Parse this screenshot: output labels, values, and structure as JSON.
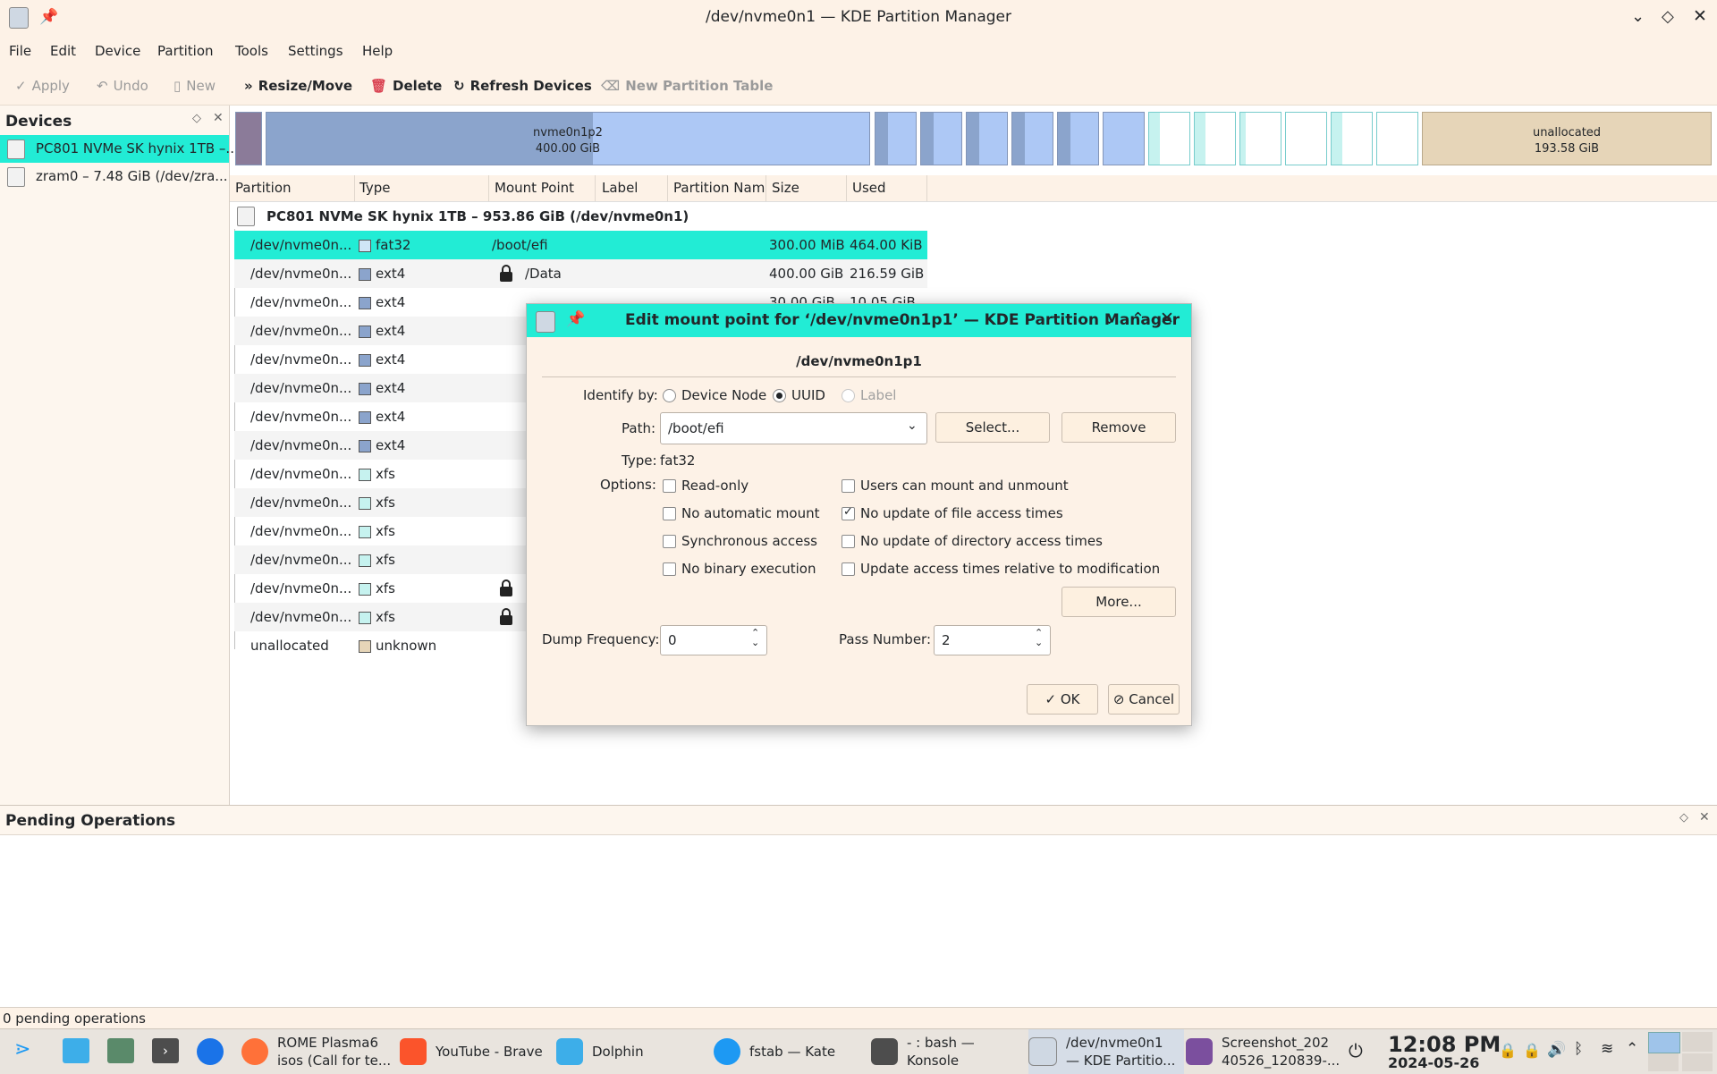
{
  "window": {
    "title": "/dev/nvme0n1 — KDE Partition Manager"
  },
  "menu": [
    "File",
    "Edit",
    "Device",
    "Partition",
    "Tools",
    "Settings",
    "Help"
  ],
  "toolbar": {
    "apply": "Apply",
    "undo": "Undo",
    "new": "New",
    "resize": "Resize/Move",
    "delete": "Delete",
    "refresh": "Refresh Devices",
    "new_table": "New Partition Table"
  },
  "devices": {
    "header": "Devices",
    "items": [
      "PC801 NVMe SK hynix 1TB –...",
      "zram0 – 7.48 GiB (/dev/zra..."
    ]
  },
  "pmap": {
    "p2_name": "nvme0n1p2",
    "p2_size": "400.00 GiB",
    "unalloc_name": "unallocated",
    "unalloc_size": "193.58 GiB"
  },
  "table": {
    "headers": [
      "Partition",
      "Type",
      "Mount Point",
      "Label",
      "Partition Nam",
      "Size",
      "Used"
    ],
    "disk_label": "PC801 NVMe SK hynix 1TB – 953.86 GiB (/dev/nvme0n1)",
    "rows": [
      {
        "part": "/dev/nvme0n...",
        "type": "fat32",
        "mount": "/boot/efi",
        "size": "300.00 MiB",
        "used": "464.00 KiB"
      },
      {
        "part": "/dev/nvme0n...",
        "type": "ext4",
        "mount": "/Data",
        "size": "400.00 GiB",
        "used": "216.59 GiB"
      },
      {
        "part": "/dev/nvme0n...",
        "type": "ext4",
        "mount": "",
        "size": "30.00 GiB",
        "used": "10.05 GiB"
      },
      {
        "part": "/dev/nvme0n...",
        "type": "ext4",
        "mount": "",
        "size": "",
        "used": ""
      },
      {
        "part": "/dev/nvme0n...",
        "type": "ext4",
        "mount": "",
        "size": "",
        "used": ""
      },
      {
        "part": "/dev/nvme0n...",
        "type": "ext4",
        "mount": "",
        "size": "",
        "used": ""
      },
      {
        "part": "/dev/nvme0n...",
        "type": "ext4",
        "mount": "",
        "size": "",
        "used": ""
      },
      {
        "part": "/dev/nvme0n...",
        "type": "ext4",
        "mount": "",
        "size": "",
        "used": ""
      },
      {
        "part": "/dev/nvme0n...",
        "type": "xfs",
        "mount": "",
        "size": "",
        "used": ""
      },
      {
        "part": "/dev/nvme0n...",
        "type": "xfs",
        "mount": "",
        "size": "",
        "used": ""
      },
      {
        "part": "/dev/nvme0n...",
        "type": "xfs",
        "mount": "",
        "size": "",
        "used": ""
      },
      {
        "part": "/dev/nvme0n...",
        "type": "xfs",
        "mount": "",
        "size": "",
        "used": ""
      },
      {
        "part": "/dev/nvme0n...",
        "type": "xfs",
        "mount": "",
        "size": "",
        "used": ""
      },
      {
        "part": "/dev/nvme0n...",
        "type": "xfs",
        "mount": "",
        "size": "",
        "used": ""
      },
      {
        "part": "unallocated",
        "type": "unknown",
        "mount": "",
        "size": "",
        "used": ""
      }
    ]
  },
  "dialog": {
    "title": "Edit mount point for ‘/dev/nvme0n1p1’ — KDE Partition Manager",
    "device": "/dev/nvme0n1p1",
    "identify_label": "Identify by:",
    "id_device_node": "Device Node",
    "id_uuid": "UUID",
    "id_label": "Label",
    "path_label": "Path:",
    "path_value": "/boot/efi",
    "select_btn": "Select...",
    "remove_btn": "Remove",
    "type_label": "Type:",
    "type_value": "fat32",
    "options_label": "Options:",
    "opt_readonly": "Read-only",
    "opt_noauto": "No automatic mount",
    "opt_sync": "Synchronous access",
    "opt_noexec": "No binary execution",
    "opt_users": "Users can mount and unmount",
    "opt_noatime": "No update of file access times",
    "opt_nodiratime": "No update of directory access times",
    "opt_relatime": "Update access times relative to modification",
    "more_btn": "More...",
    "dump_label": "Dump Frequency:",
    "dump_value": "0",
    "pass_label": "Pass Number:",
    "pass_value": "2",
    "ok_btn": "OK",
    "cancel_btn": "Cancel"
  },
  "pending": {
    "header": "Pending Operations",
    "status": "0 pending operations"
  },
  "taskbar": {
    "rome": "ROME Plasma6",
    "rome2": "isos (Call for te...",
    "youtube": "YouTube - Brave",
    "dolphin": "Dolphin",
    "kate": "fstab — Kate",
    "konsole1": "- : bash —",
    "konsole2": "Konsole",
    "kpm1": "/dev/nvme0n1",
    "kpm2": "— KDE Partitio...",
    "shot1": "Screenshot_202",
    "shot2": "40526_120839-...",
    "time": "12:08 PM",
    "date": "2024-05-26"
  }
}
